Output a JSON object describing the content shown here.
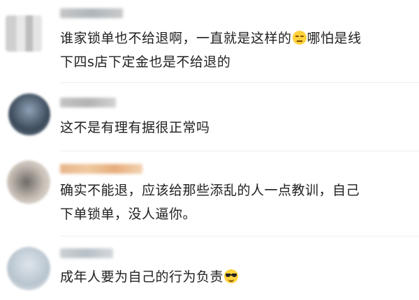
{
  "comments": [
    {
      "text_lines": [
        "谁家锁单也不给退啊，一直就是这样的",
        "哪怕是线",
        "下四s店下定金也是不给退的"
      ],
      "emoji": "unamused-face-icon"
    },
    {
      "text": "这不是有理有据很正常吗"
    },
    {
      "text_lines": [
        "确实不能退，应该给那些添乱的人一点教训，自己",
        "下单锁单，没人逼你。"
      ]
    },
    {
      "text": "成年人要为自己的行为负责",
      "emoji": "sunglasses-face-icon"
    }
  ],
  "colors": {
    "text": "#1f1f1f",
    "divider": "#eeeeee",
    "emoji": "#ffd23c"
  }
}
